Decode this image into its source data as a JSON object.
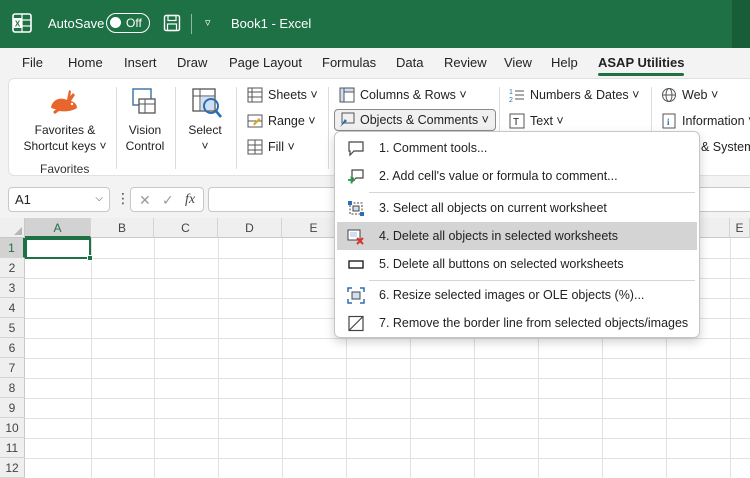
{
  "titlebar": {
    "autosave_label": "AutoSave",
    "autosave_state": "Off",
    "doc_title": "Book1  -  Excel",
    "brand_color": "#1e7145"
  },
  "tabs": [
    "File",
    "Home",
    "Insert",
    "Draw",
    "Page Layout",
    "Formulas",
    "Data",
    "Review",
    "View",
    "Help",
    "ASAP Utilities"
  ],
  "active_tab": "ASAP Utilities",
  "ribbon": {
    "favorites_label_1": "Favorites &",
    "favorites_label_2": "Shortcut keys ˅",
    "favorites_group": "Favorites",
    "vision_label_1": "Vision",
    "vision_label_2": "Control",
    "select_label": "Select",
    "select_arrow": "˅",
    "sheets": "Sheets ˅",
    "range": "Range ˅",
    "fill": "Fill ˅",
    "columns_rows": "Columns & Rows ˅",
    "objects_comments": "Objects & Comments ˅",
    "numbers_dates": "Numbers & Dates ˅",
    "text": "Text ˅",
    "web": "Web ˅",
    "information": "Information ˅",
    "system": "& System"
  },
  "formula_bar": {
    "name_box": "A1",
    "cancel": "✕",
    "enter": "✓",
    "fx": "fx",
    "formula": ""
  },
  "grid": {
    "columns": [
      "A",
      "B",
      "C",
      "D",
      "E",
      "",
      "",
      "",
      "",
      "",
      "",
      "E"
    ],
    "rows": [
      "1",
      "2",
      "3",
      "4",
      "5",
      "6",
      "7",
      "8",
      "9",
      "10",
      "11",
      "12"
    ],
    "active_cell": "A1"
  },
  "menu": {
    "items": [
      {
        "label": "1. Comment tools...",
        "icon": "comment-icon"
      },
      {
        "label": "2. Add cell's value or formula to comment...",
        "icon": "add-comment-icon"
      },
      {
        "label": "3. Select all objects on current worksheet",
        "icon": "select-objects-icon"
      },
      {
        "label": "4. Delete all objects in selected worksheets",
        "icon": "delete-objects-icon"
      },
      {
        "label": "5. Delete all buttons on selected worksheets",
        "icon": "button-icon"
      },
      {
        "label": "6. Resize selected images or OLE objects (%)...",
        "icon": "resize-icon"
      },
      {
        "label": "7. Remove the border line from selected objects/images",
        "icon": "border-icon"
      }
    ],
    "hovered_index": 3
  }
}
